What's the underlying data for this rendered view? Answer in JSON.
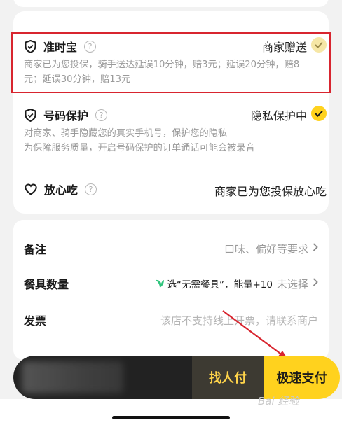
{
  "protection": {
    "ontime": {
      "title": "准时宝",
      "status": "商家赠送",
      "desc_line1": "商家已为您投保，骑手送达延误10分钟，赔3元；延误20分钟，赔8",
      "desc_line2": "元；延误30分钟，赔13元"
    },
    "number": {
      "title": "号码保护",
      "status": "隐私保护中",
      "desc_line1": "对商家、骑手隐藏您的真实手机号，保护您的隐私",
      "desc_line2": "为保障服务质量，开启号码保护的订单通话可能会被录音"
    },
    "safe_eat": {
      "title": "放心吃",
      "status": "商家已为您投保放心吃"
    },
    "help_glyph": "?"
  },
  "extras": {
    "remark": {
      "label": "备注",
      "value": "口味、偏好等要求"
    },
    "tableware": {
      "label": "餐具数量",
      "promo": "选“无需餐具”，能量+10",
      "value": "未选择"
    },
    "invoice": {
      "label": "发票",
      "value": "该店不支持线上开票，请联系商户"
    }
  },
  "paybar": {
    "friend_pay": "找人付",
    "fast_pay": "极速支付"
  },
  "watermark": "Bai 经验",
  "colors": {
    "accent_yellow": "#ffd21e",
    "highlight_red": "#d8252f",
    "leaf_green": "#2fc47c"
  }
}
